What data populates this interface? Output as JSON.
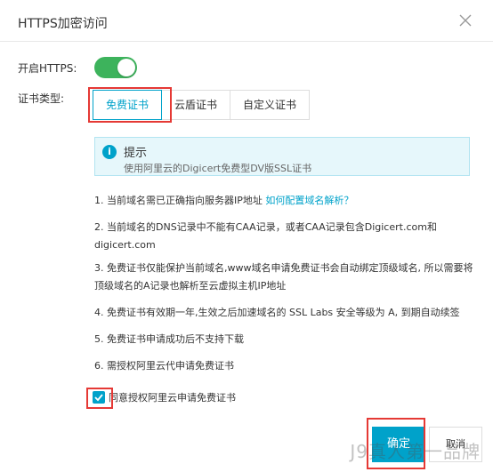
{
  "dialog": {
    "title": "HTTPS加密访问",
    "https_label": "开启HTTPS:",
    "https_enabled": true,
    "cert_type_label": "证书类型:",
    "cert_tabs": [
      {
        "label": "免费证书",
        "active": true
      },
      {
        "label": "云盾证书",
        "active": false
      },
      {
        "label": "自定义证书",
        "active": false
      }
    ],
    "info": {
      "title": "提示",
      "desc": "使用阿里云的Digicert免费型DV版SSL证书"
    },
    "notes": {
      "n1_text": "1. 当前域名需已正确指向服务器IP地址",
      "n1_link": "如何配置域名解析？",
      "n2": "2. 当前域名的DNS记录中不能有CAA记录，或者CAA记录包含Digicert.com和digicert.com",
      "n3": "3. 免费证书仅能保护当前域名,www域名申请免费证书会自动绑定顶级域名, 所以需要将顶级域名的A记录也解析至云虚拟主机IP地址",
      "n4": "4. 免费证书有效期一年,生效之后加速域名的 SSL Labs 安全等级为 A, 到期自动续签",
      "n5": "5. 免费证书申请成功后不支持下载",
      "n6": "6. 需授权阿里云代申请免费证书"
    },
    "agree_label": "同意授权阿里云申请免费证书",
    "agree_checked": true,
    "confirm_label": "确定",
    "cancel_label": "取消"
  },
  "watermark": "J9真人第一品牌",
  "colors": {
    "accent": "#00a2ca",
    "toggle_on": "#3db35c",
    "highlight_red": "#e53935",
    "info_bg": "#e6f7fb"
  }
}
